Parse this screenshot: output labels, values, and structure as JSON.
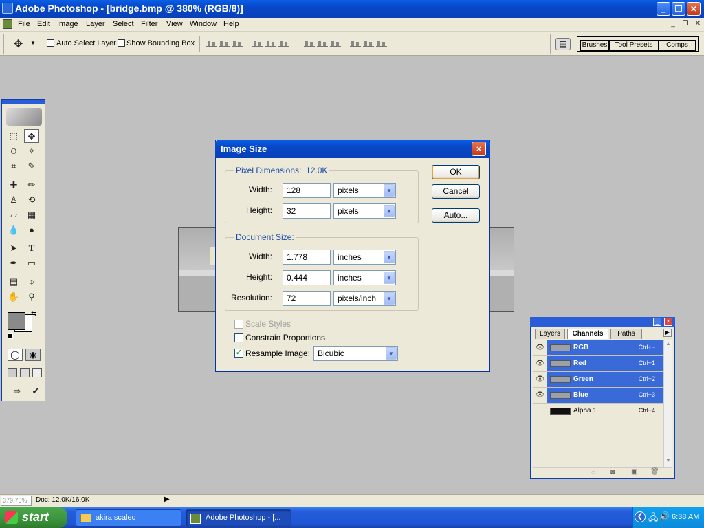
{
  "window": {
    "title": "Adobe Photoshop - [bridge.bmp @ 380% (RGB/8)]"
  },
  "menu": [
    "File",
    "Edit",
    "Image",
    "Layer",
    "Select",
    "Filter",
    "View",
    "Window",
    "Help"
  ],
  "options_bar": {
    "auto_select_label": "Auto Select Layer",
    "auto_select_checked": false,
    "bounding_box_label": "Show Bounding Box",
    "bounding_box_checked": false
  },
  "palette_well": {
    "tabs": [
      "Brushes",
      "Tool Presets",
      "Comps"
    ]
  },
  "dialog": {
    "title": "Image Size",
    "close_glyph": "×",
    "pixel_dimensions": {
      "label": "Pixel Dimensions:",
      "size": "12.0K",
      "width_label": "Width:",
      "width_value": "128",
      "width_unit": "pixels",
      "height_label": "Height:",
      "height_value": "32",
      "height_unit": "pixels"
    },
    "document_size": {
      "label": "Document Size:",
      "width_label": "Width:",
      "width_value": "1.778",
      "width_unit": "inches",
      "height_label": "Height:",
      "height_value": "0.444",
      "height_unit": "inches",
      "resolution_label": "Resolution:",
      "resolution_value": "72",
      "resolution_unit": "pixels/inch"
    },
    "scale_styles_label": "Scale Styles",
    "scale_styles_enabled": false,
    "constrain_label": "Constrain Proportions",
    "constrain_checked": false,
    "resample_label": "Resample Image:",
    "resample_checked": true,
    "resample_method": "Bicubic",
    "buttons": {
      "ok": "OK",
      "cancel": "Cancel",
      "auto": "Auto..."
    }
  },
  "channels_palette": {
    "tabs": [
      "Layers",
      "Channels",
      "Paths"
    ],
    "active_tab": "Channels",
    "rows": [
      {
        "name": "RGB",
        "shortcut": "Ctrl+~",
        "selected": true,
        "visible": true
      },
      {
        "name": "Red",
        "shortcut": "Ctrl+1",
        "selected": true,
        "visible": true
      },
      {
        "name": "Green",
        "shortcut": "Ctrl+2",
        "selected": true,
        "visible": true
      },
      {
        "name": "Blue",
        "shortcut": "Ctrl+3",
        "selected": true,
        "visible": true
      },
      {
        "name": "Alpha 1",
        "shortcut": "Ctrl+4",
        "selected": false,
        "visible": false
      }
    ]
  },
  "status_bar": {
    "zoom": "379.75%",
    "doc": "Doc: 12.0K/16.0K"
  },
  "taskbar": {
    "start_label": "start",
    "tasks": [
      {
        "label": "akira scaled",
        "active": false
      },
      {
        "label": "Adobe Photoshop - [...",
        "active": true
      }
    ],
    "clock": "6:38 AM"
  },
  "colors": {
    "xp_blue": "#0848c8",
    "dialog_bg": "#ece9d8",
    "workspace": "#c0c0c0",
    "selection": "#3a6ad8"
  }
}
